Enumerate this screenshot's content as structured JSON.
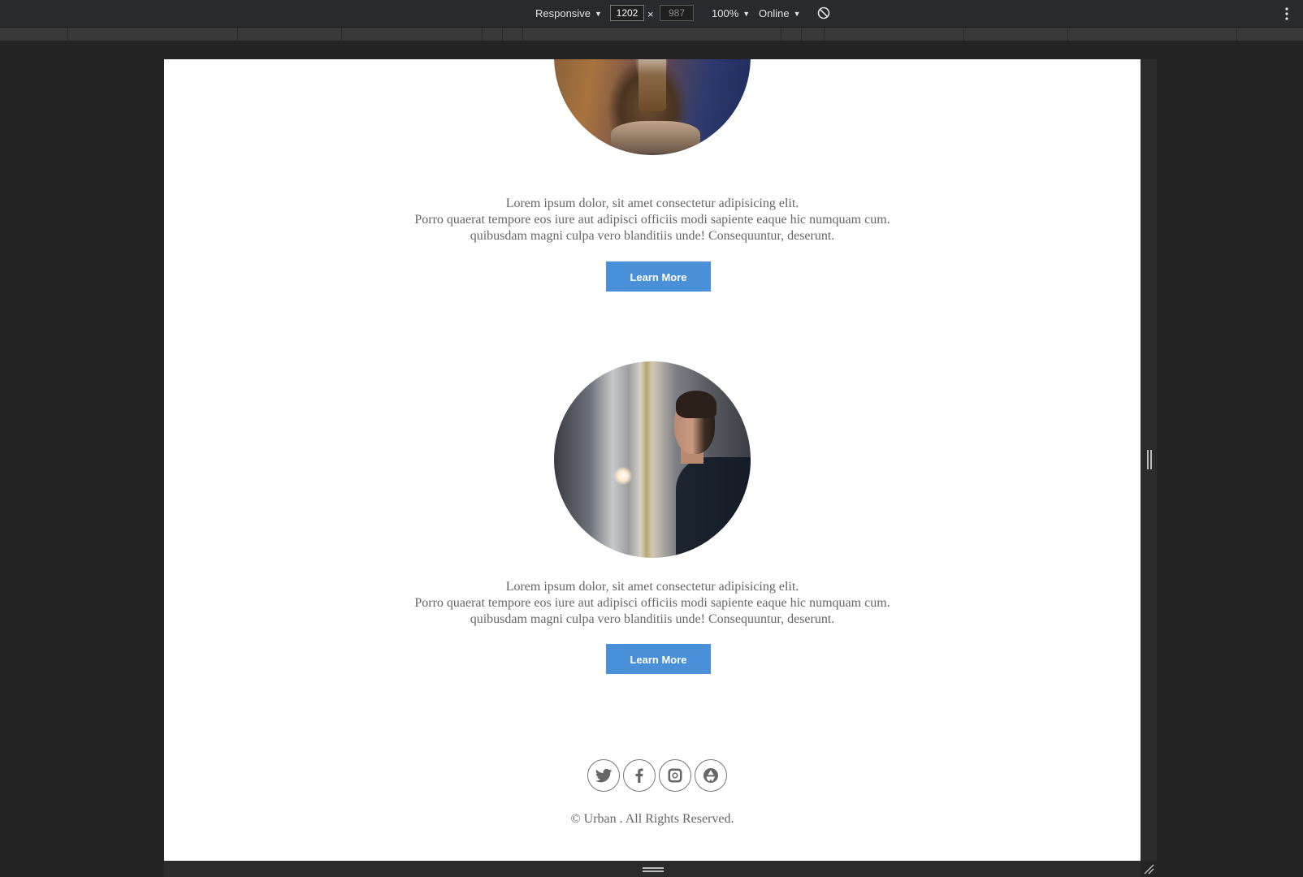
{
  "devtools": {
    "device_label": "Responsive",
    "width_value": "1202",
    "height_value": "987",
    "times": "×",
    "zoom_label": "100%",
    "network_label": "Online",
    "caret": "▼",
    "icons": {
      "rotate": "rotate-icon",
      "menu": "more-vert-icon"
    }
  },
  "page": {
    "items": [
      {
        "lines": [
          "Lorem ipsum dolor, sit amet consectetur adipisicing elit.",
          "Porro quaerat tempore eos iure aut adipisci officiis modi sapiente eaque hic numquam cum.",
          "quibusdam magni culpa vero blanditiis unde! Consequuntur, deserunt."
        ],
        "button": "Learn More"
      },
      {
        "lines": [
          "Lorem ipsum dolor, sit amet consectetur adipisicing elit.",
          "Porro quaerat tempore eos iure aut adipisci officiis modi sapiente eaque hic numquam cum.",
          "quibusdam magni culpa vero blanditiis unde! Consequuntur, deserunt."
        ],
        "button": "Learn More"
      }
    ],
    "footer": {
      "socials": [
        "twitter-icon",
        "facebook-icon",
        "instagram-icon",
        "picasa-icon"
      ],
      "copyright": "© Urban . All Rights Reserved."
    }
  },
  "colors": {
    "button": "#4a90d9",
    "text": "#666666",
    "devtools_bg": "#292a2d"
  }
}
